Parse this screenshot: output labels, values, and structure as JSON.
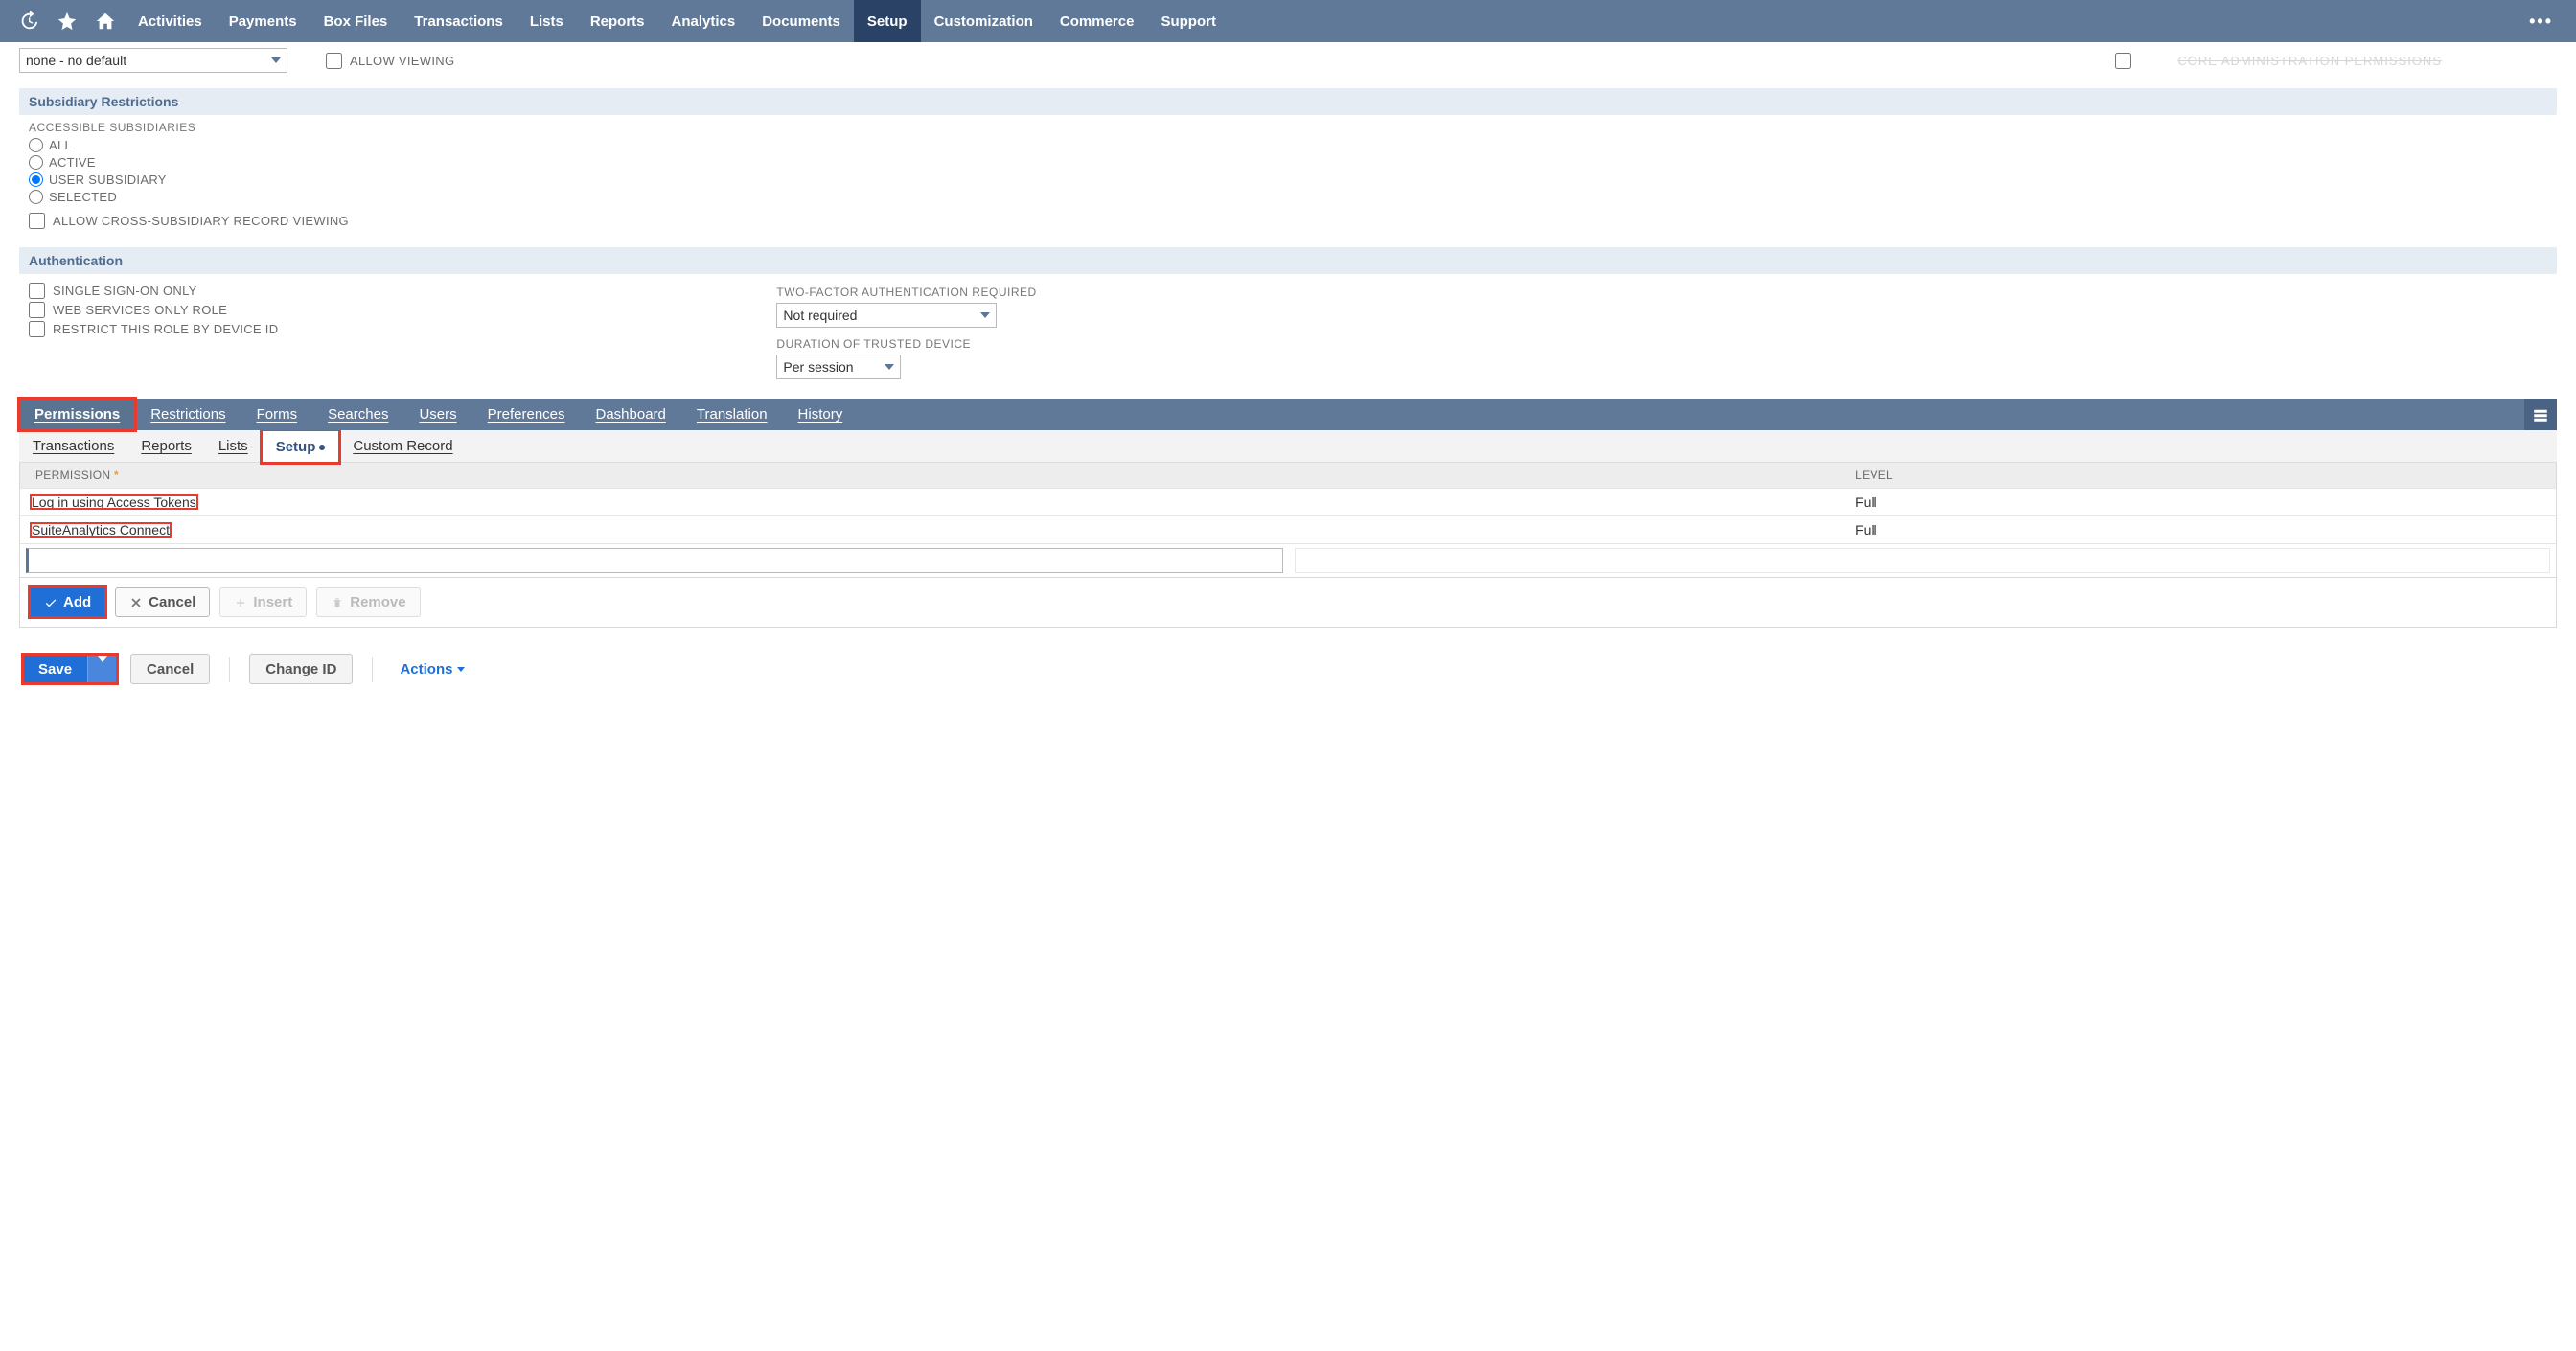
{
  "nav": {
    "items": [
      "Activities",
      "Payments",
      "Box Files",
      "Transactions",
      "Lists",
      "Reports",
      "Analytics",
      "Documents",
      "Setup",
      "Customization",
      "Commerce",
      "Support"
    ],
    "active": "Setup"
  },
  "top_field": {
    "select_value": "none - no default",
    "allow_viewing": "ALLOW VIEWING",
    "cutoff_label": "CORE ADMINISTRATION PERMISSIONS"
  },
  "subsidiary": {
    "heading": "Subsidiary Restrictions",
    "label": "ACCESSIBLE SUBSIDIARIES",
    "options": [
      "ALL",
      "ACTIVE",
      "USER SUBSIDIARY",
      "SELECTED"
    ],
    "selected": "USER SUBSIDIARY",
    "cross_label": "ALLOW CROSS-SUBSIDIARY RECORD VIEWING"
  },
  "auth": {
    "heading": "Authentication",
    "checks": [
      "SINGLE SIGN-ON ONLY",
      "WEB SERVICES ONLY ROLE",
      "RESTRICT THIS ROLE BY DEVICE ID"
    ],
    "tfa_label": "TWO-FACTOR AUTHENTICATION REQUIRED",
    "tfa_value": "Not required",
    "dur_label": "DURATION OF TRUSTED DEVICE",
    "dur_value": "Per session"
  },
  "tabs": [
    "Permissions",
    "Restrictions",
    "Forms",
    "Searches",
    "Users",
    "Preferences",
    "Dashboard",
    "Translation",
    "History"
  ],
  "active_tab": "Permissions",
  "subtabs": [
    "Transactions",
    "Reports",
    "Lists",
    "Setup",
    "Custom Record"
  ],
  "active_subtab": "Setup",
  "table": {
    "headers": {
      "permission": "PERMISSION",
      "level": "LEVEL"
    },
    "rows": [
      {
        "permission": "Log in using Access Tokens",
        "level": "Full"
      },
      {
        "permission": "SuiteAnalytics Connect",
        "level": "Full"
      }
    ]
  },
  "tbl_buttons": {
    "add": "Add",
    "cancel": "Cancel",
    "insert": "Insert",
    "remove": "Remove"
  },
  "footer": {
    "save": "Save",
    "cancel": "Cancel",
    "change_id": "Change ID",
    "actions": "Actions"
  }
}
